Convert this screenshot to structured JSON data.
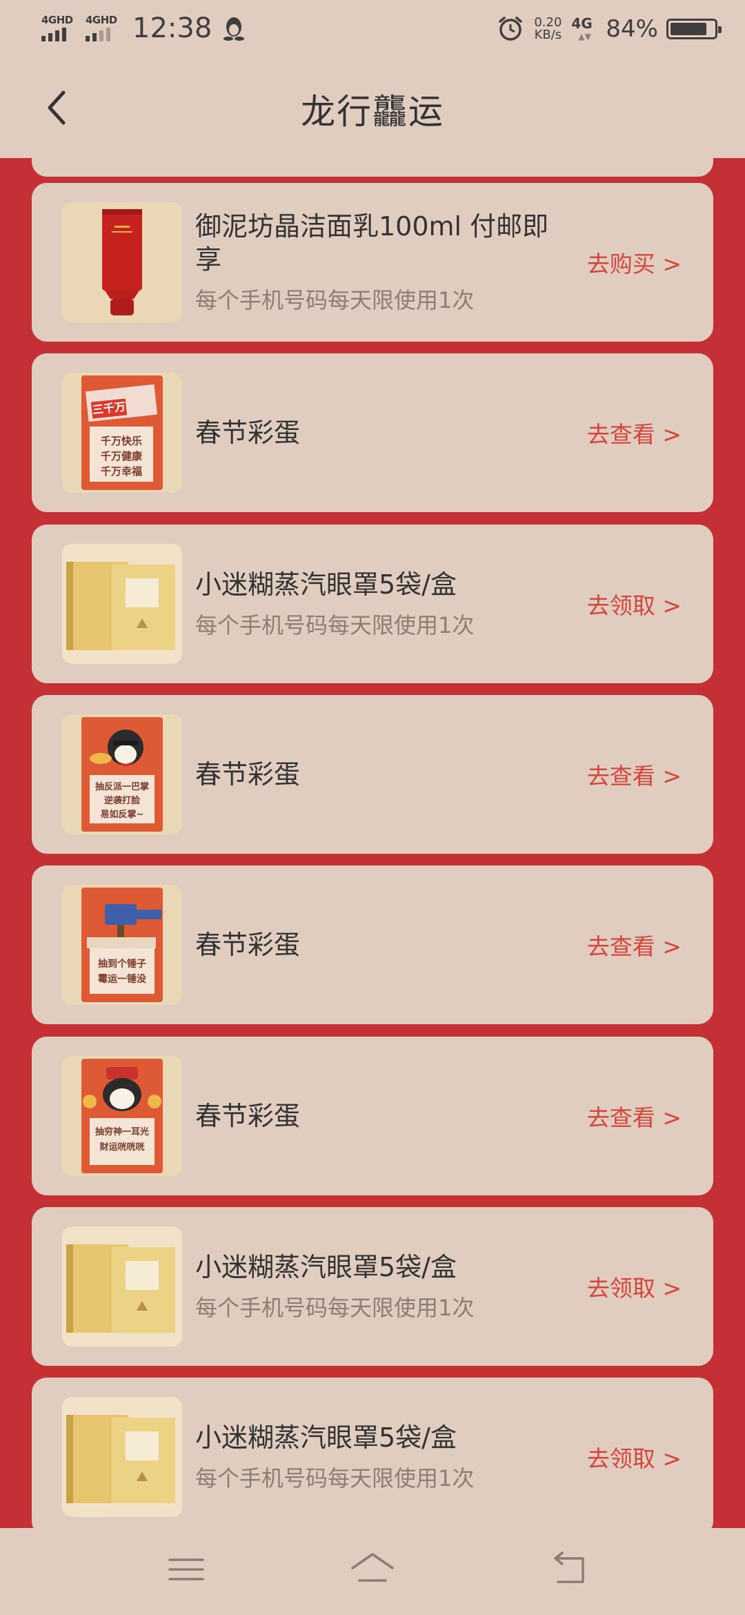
{
  "status_bar": {
    "signal1": "4GHD",
    "signal2": "4GHD",
    "time": "12:38",
    "net_speed": "0.20",
    "net_unit": "KB/s",
    "network": "4G",
    "battery_pct": "84%"
  },
  "header": {
    "title": "龙行龘运"
  },
  "items": [
    {
      "title": "御泥坊晶洁面乳100ml 付邮即享",
      "subtitle": "每个手机号码每天限使用1次",
      "action": "去购买 >"
    },
    {
      "title": "春节彩蛋",
      "subtitle": "",
      "action": "去查看 >",
      "thumb_text": [
        "三千万",
        "千万快乐",
        "千万健康",
        "千万幸福"
      ]
    },
    {
      "title": "小迷糊蒸汽眼罩5袋/盒",
      "subtitle": "每个手机号码每天限使用1次",
      "action": "去领取 >"
    },
    {
      "title": "春节彩蛋",
      "subtitle": "",
      "action": "去查看 >",
      "thumb_text": [
        "抽反派一巴掌",
        "逆袭打脸",
        "易如反掌~"
      ]
    },
    {
      "title": "春节彩蛋",
      "subtitle": "",
      "action": "去查看 >",
      "thumb_text": [
        "抽到个锤子",
        "霉运一锤没"
      ]
    },
    {
      "title": "春节彩蛋",
      "subtitle": "",
      "action": "去查看 >",
      "thumb_text": [
        "抽穷神一耳光",
        "财运咣咣咣"
      ]
    },
    {
      "title": "小迷糊蒸汽眼罩5袋/盒",
      "subtitle": "每个手机号码每天限使用1次",
      "action": "去领取 >"
    },
    {
      "title": "小迷糊蒸汽眼罩5袋/盒",
      "subtitle": "每个手机号码每天限使用1次",
      "action": "去领取 >"
    }
  ],
  "colors": {
    "page_bg": "#e0cdbf",
    "list_bg": "#c43033",
    "action": "#d4453d"
  }
}
